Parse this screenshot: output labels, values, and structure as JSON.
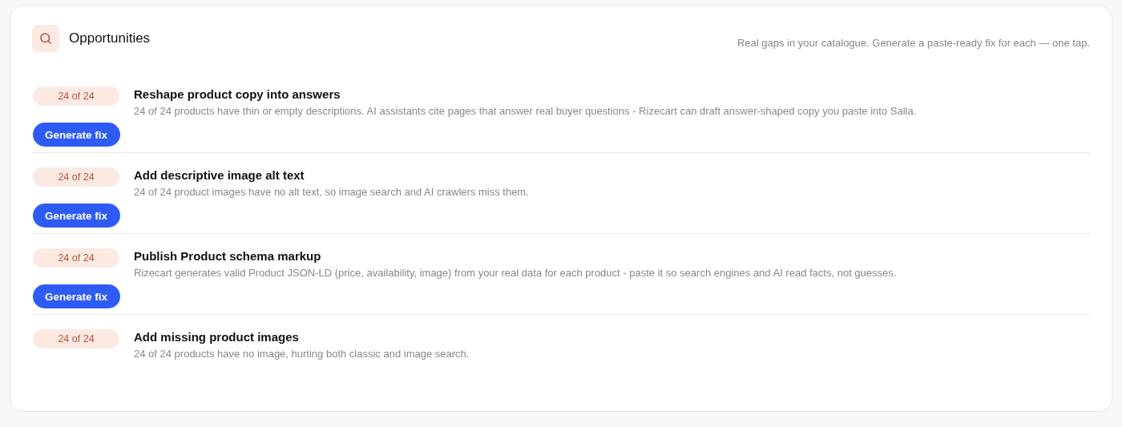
{
  "header": {
    "title": "Opportunities",
    "subtitle": "Real gaps in your catalogue. Generate a paste-ready fix for each — one tap."
  },
  "items": [
    {
      "count": "24 of 24",
      "title": "Reshape product copy into answers",
      "description": "24 of 24 products have thin or empty descriptions. AI assistants cite pages that answer real buyer questions - Rizecart can draft answer-shaped copy you paste into Salla.",
      "action": "Generate fix"
    },
    {
      "count": "24 of 24",
      "title": "Add descriptive image alt text",
      "description": "24 of 24 product images have no alt text, so image search and AI crawlers miss them.",
      "action": "Generate fix"
    },
    {
      "count": "24 of 24",
      "title": "Publish Product schema markup",
      "description": "Rizecart generates valid Product JSON-LD (price, availability, image) from your real data for each product - paste it so search engines and AI read facts, not guesses.",
      "action": "Generate fix"
    },
    {
      "count": "24 of 24",
      "title": "Add missing product images",
      "description": "24 of 24 products have no image, hurting both classic and image search."
    }
  ]
}
